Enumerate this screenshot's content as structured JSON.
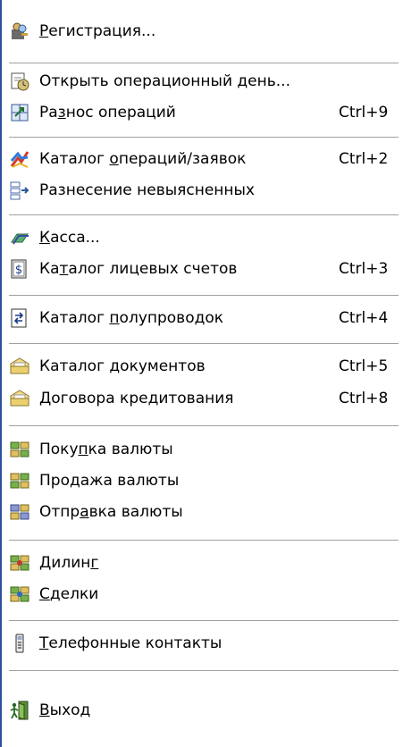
{
  "menu": {
    "items": [
      {
        "id": "registration",
        "icon": "key-users-icon",
        "pre": "",
        "ul": "Р",
        "post": "егистрация...",
        "shortcut": ""
      },
      {
        "id": "open-day",
        "icon": "open-day-icon",
        "pre": "Открыть операционный ",
        "ul": "д",
        "post": "ень...",
        "shortcut": ""
      },
      {
        "id": "post-ops",
        "icon": "post-operations-icon",
        "pre": "Ра",
        "ul": "з",
        "post": "нос операций",
        "shortcut": "Ctrl+9"
      },
      {
        "id": "ops-catalog",
        "icon": "operations-catalog-icon",
        "pre": "Каталог ",
        "ul": "о",
        "post": "пераций/заявок",
        "shortcut": "Ctrl+2"
      },
      {
        "id": "unclear",
        "icon": "unclear-posting-icon",
        "pre": "",
        "ul": "",
        "post": "Разнесение невыясненных",
        "shortcut": ""
      },
      {
        "id": "cash",
        "icon": "cash-icon",
        "pre": "",
        "ul": "К",
        "post": "асса...",
        "shortcut": ""
      },
      {
        "id": "accounts",
        "icon": "accounts-catalog-icon",
        "pre": "Ка",
        "ul": "т",
        "post": "алог лицевых счетов",
        "shortcut": "Ctrl+3"
      },
      {
        "id": "semi",
        "icon": "semi-entries-icon",
        "pre": "Каталог ",
        "ul": "п",
        "post": "олупроводок",
        "shortcut": "Ctrl+4"
      },
      {
        "id": "docs",
        "icon": "folder-icon",
        "pre": "",
        "ul": "",
        "post": "Каталог документов",
        "shortcut": "Ctrl+5"
      },
      {
        "id": "credit",
        "icon": "folder-icon",
        "pre": "",
        "ul": "",
        "post": "Договора кредитования",
        "shortcut": "Ctrl+8"
      },
      {
        "id": "buy",
        "icon": "currency-buy-icon",
        "pre": "Поку",
        "ul": "п",
        "post": "ка валюты",
        "shortcut": ""
      },
      {
        "id": "sell",
        "icon": "currency-sell-icon",
        "pre": "Про",
        "ul": "д",
        "post": "ажа валюты",
        "shortcut": ""
      },
      {
        "id": "send",
        "icon": "currency-send-icon",
        "pre": "Отпр",
        "ul": "а",
        "post": "вка валюты",
        "shortcut": ""
      },
      {
        "id": "dealing",
        "icon": "dealing-icon",
        "pre": "Дилин",
        "ul": "г",
        "post": "",
        "shortcut": ""
      },
      {
        "id": "deals",
        "icon": "deals-icon",
        "pre": "",
        "ul": "С",
        "post": "делки",
        "shortcut": ""
      },
      {
        "id": "phones",
        "icon": "phone-icon",
        "pre": "",
        "ul": "Т",
        "post": "елефонные контакты",
        "shortcut": ""
      },
      {
        "id": "exit",
        "icon": "exit-door-icon",
        "pre": "",
        "ul": "В",
        "post": "ыход",
        "shortcut": ""
      }
    ]
  }
}
